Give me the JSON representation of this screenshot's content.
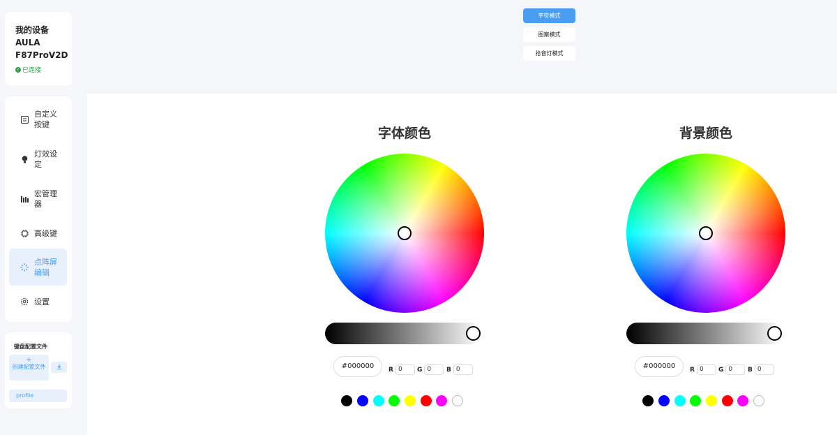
{
  "device": {
    "heading": "我的设备",
    "model_line1": "AULA",
    "model_line2": "F87ProV2D",
    "status": "已连接"
  },
  "nav": {
    "items": [
      {
        "label": "自定义按键",
        "icon": "keyboard-icon"
      },
      {
        "label": "灯效设定",
        "icon": "bulb-icon"
      },
      {
        "label": "宏管理器",
        "icon": "macro-icon"
      },
      {
        "label": "高级键",
        "icon": "chip-icon"
      },
      {
        "label": "点阵屏编辑",
        "icon": "sparkle-icon",
        "active": true
      },
      {
        "label": "设置",
        "icon": "gear-icon"
      }
    ]
  },
  "profiles": {
    "title": "键盘配置文件",
    "create_label": "创建配置文件",
    "create_icon": "+",
    "import_icon": "download-icon",
    "items": [
      "profile"
    ]
  },
  "modes": {
    "items": [
      "字符模式",
      "图案模式",
      "拾音灯模式"
    ],
    "active_index": 0
  },
  "pickers": [
    {
      "title": "字体颜色",
      "hex": "#000000",
      "r": "0",
      "g": "0",
      "b": "0",
      "brightness": 1.0
    },
    {
      "title": "背景颜色",
      "hex": "#000000",
      "r": "0",
      "g": "0",
      "b": "0",
      "brightness": 1.0
    }
  ],
  "rgb_labels": {
    "r": "R",
    "g": "G",
    "b": "B"
  },
  "swatches": [
    "#000000",
    "#0000ff",
    "#00ffff",
    "#00ff00",
    "#ffff00",
    "#ff0000",
    "#ff00ff",
    "#ffffff"
  ],
  "colors": {
    "accent": "#4a9df0",
    "status": "#2ea043"
  }
}
